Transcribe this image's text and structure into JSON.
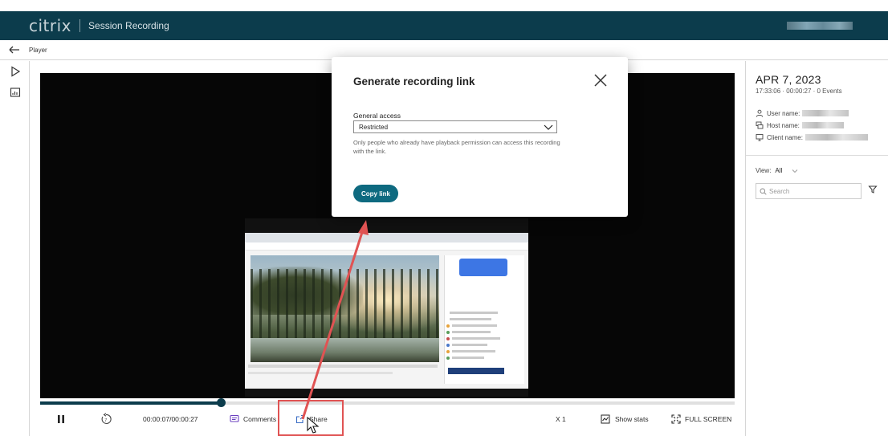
{
  "app": {
    "logo": "citrix",
    "title": "Session Recording"
  },
  "breadcrumb": {
    "label": "Player"
  },
  "rail": {
    "items": [
      "play-icon",
      "stats-icon"
    ]
  },
  "player": {
    "playback_fraction": 0.26,
    "time": "00:00:07/00:00:27",
    "comments_label": "Comments",
    "share_label": "Share",
    "speed_label": "X 1",
    "show_stats_label": "Show stats",
    "fullscreen_label": "FULL SCREEN"
  },
  "details": {
    "date": "APR 7, 2023",
    "subline": "17:33:06 · 00:00:27 · 0 Events",
    "user_label": "User name:",
    "host_label": "Host name:",
    "client_label": "Client name:",
    "view_label": "View:",
    "view_value": "All",
    "search_placeholder": "Search"
  },
  "modal": {
    "title": "Generate recording link",
    "access_label": "General access",
    "access_value": "Restricted",
    "help_text": "Only people who already have playback permission can access this recording with the link.",
    "copy_label": "Copy link"
  },
  "colors": {
    "brand": "#0c3c4c",
    "accent_button": "#0e6a80",
    "annotation": "#e05353"
  }
}
